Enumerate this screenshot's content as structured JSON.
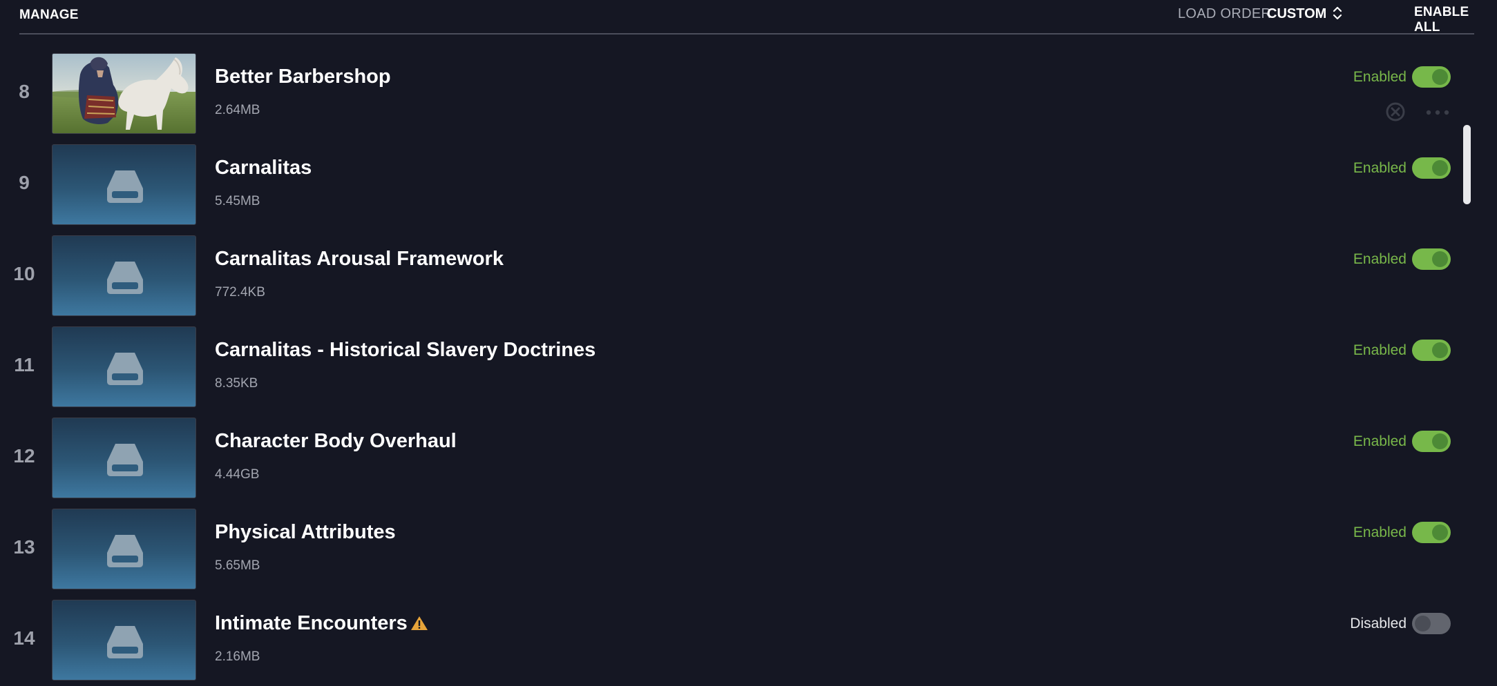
{
  "header": {
    "manage_label": "MANAGE",
    "load_order_label": "LOAD ORDER",
    "load_order_value": "CUSTOM",
    "enable_all_label": "ENABLE ALL"
  },
  "colors": {
    "background": "#151723",
    "enabled_green": "#79b84a",
    "toggle_on": "#77b84a",
    "toggle_off": "#62656e",
    "warning": "#e7a43a"
  },
  "mods": [
    {
      "index": "8",
      "name": "Better Barbershop",
      "size": "2.64MB",
      "status": "Enabled",
      "enabled": true,
      "thumbnail": "rider-on-white-horse-image",
      "warning": false
    },
    {
      "index": "9",
      "name": "Carnalitas",
      "size": "5.45MB",
      "status": "Enabled",
      "enabled": true,
      "thumbnail": "drive-icon",
      "warning": false
    },
    {
      "index": "10",
      "name": "Carnalitas Arousal Framework",
      "size": "772.4KB",
      "status": "Enabled",
      "enabled": true,
      "thumbnail": "drive-icon",
      "warning": false
    },
    {
      "index": "11",
      "name": "Carnalitas - Historical Slavery Doctrines",
      "size": "8.35KB",
      "status": "Enabled",
      "enabled": true,
      "thumbnail": "drive-icon",
      "warning": false
    },
    {
      "index": "12",
      "name": "Character Body Overhaul",
      "size": "4.44GB",
      "status": "Enabled",
      "enabled": true,
      "thumbnail": "drive-icon",
      "warning": false
    },
    {
      "index": "13",
      "name": "Physical Attributes",
      "size": "5.65MB",
      "status": "Enabled",
      "enabled": true,
      "thumbnail": "drive-icon",
      "warning": false
    },
    {
      "index": "14",
      "name": "Intimate Encounters",
      "size": "2.16MB",
      "status": "Disabled",
      "enabled": false,
      "thumbnail": "drive-icon",
      "warning": true
    }
  ],
  "row_actions": {
    "icons": [
      "remove-icon",
      "more-options-icon"
    ]
  }
}
